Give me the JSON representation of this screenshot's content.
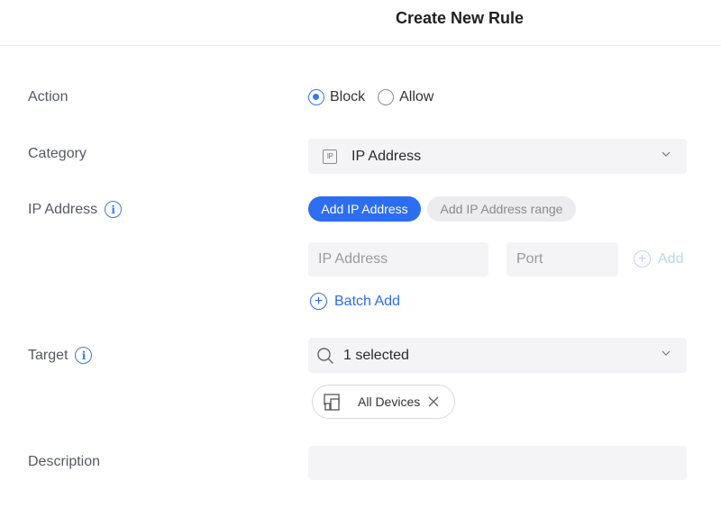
{
  "header": {
    "title": "Create New Rule"
  },
  "labels": {
    "action": "Action",
    "category": "Category",
    "ip_address": "IP Address",
    "target": "Target",
    "description": "Description"
  },
  "action": {
    "options": [
      "Block",
      "Allow"
    ],
    "selected": "Block"
  },
  "category": {
    "value": "IP Address",
    "icon": "ip-icon",
    "icon_text": "IP"
  },
  "ip_mode": {
    "add_single": "Add IP Address",
    "add_range": "Add IP Address range",
    "active": "Add IP Address"
  },
  "ip_inputs": {
    "ip_placeholder": "IP Address",
    "port_placeholder": "Port",
    "add_label": "Add"
  },
  "batch_add": {
    "label": "Batch Add"
  },
  "target": {
    "value": "1 selected",
    "tags": [
      "All Devices"
    ]
  },
  "description": {
    "placeholder": ""
  },
  "colors": {
    "accent": "#2d6df0",
    "field_bg": "#f4f4f6",
    "disabled_link": "#bcd2f8"
  }
}
